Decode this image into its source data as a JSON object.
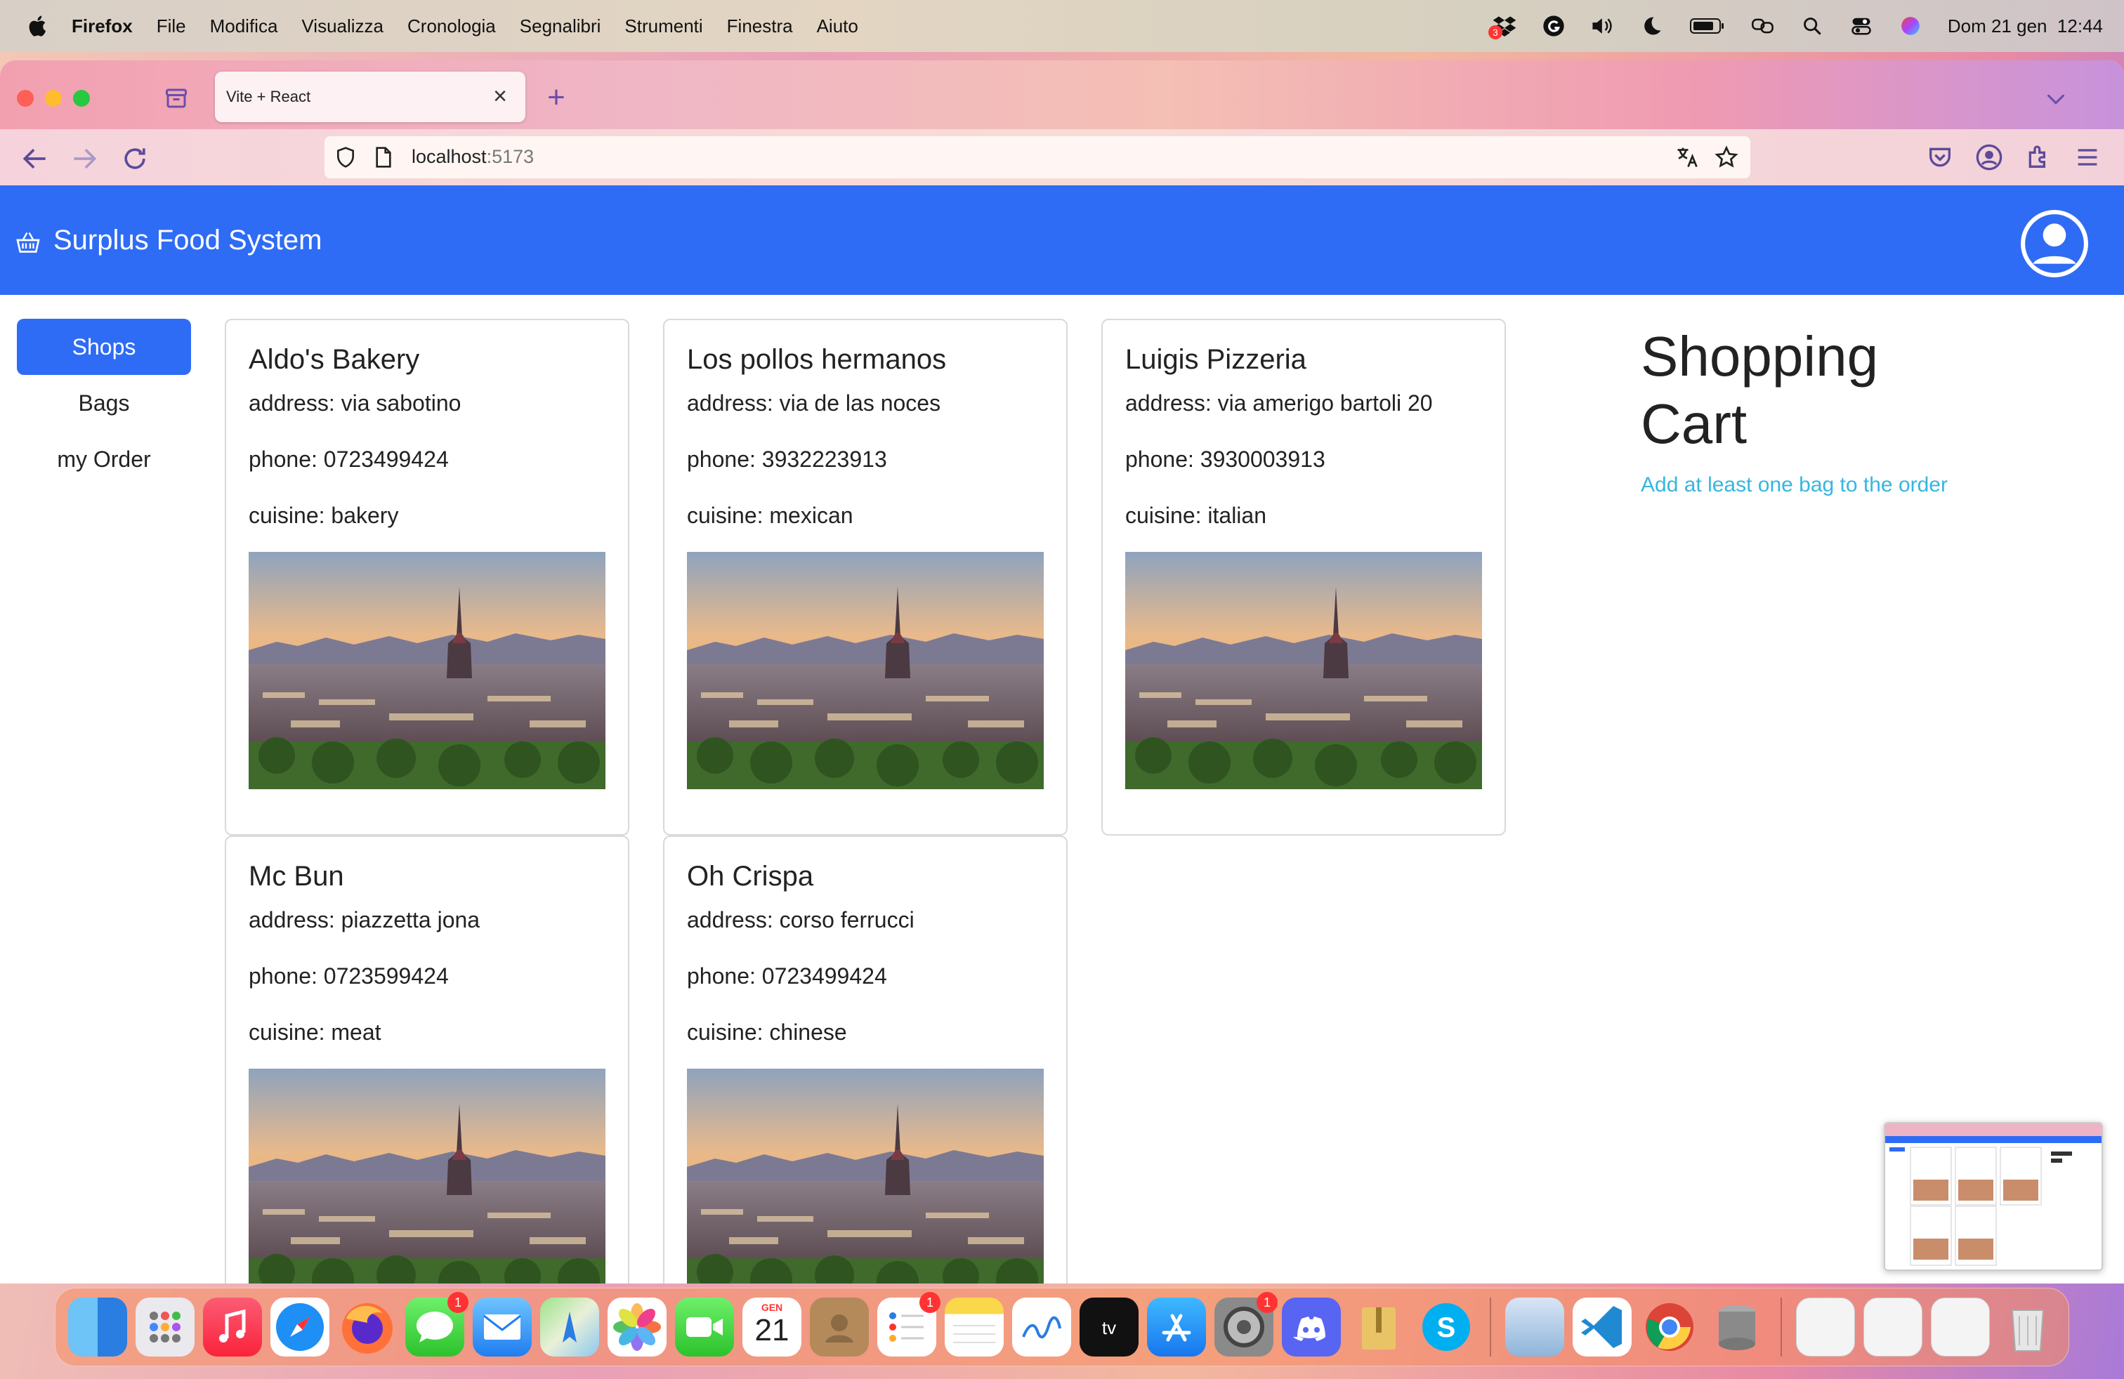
{
  "menubar": {
    "app": "Firefox",
    "items": [
      "File",
      "Modifica",
      "Visualizza",
      "Cronologia",
      "Segnalibri",
      "Strumenti",
      "Finestra",
      "Aiuto"
    ],
    "clock": "Dom 21 gen  12:44",
    "dropbox_badge": "3"
  },
  "browser": {
    "tab_title": "Vite + React",
    "url_host": "localhost",
    "url_port": ":5173"
  },
  "app": {
    "brand": "Surplus Food System",
    "sidebar": [
      "Shops",
      "Bags",
      "my Order"
    ],
    "shops": [
      {
        "name": "Aldo's Bakery",
        "address": "address: via sabotino",
        "phone": "phone: 0723499424",
        "cuisine": "cuisine: bakery"
      },
      {
        "name": "Los pollos hermanos",
        "address": "address: via de las noces",
        "phone": "phone: 3932223913",
        "cuisine": "cuisine: mexican"
      },
      {
        "name": "Luigis Pizzeria",
        "address": "address: via amerigo bartoli 20",
        "phone": "phone: 3930003913",
        "cuisine": "cuisine: italian"
      },
      {
        "name": "Mc Bun",
        "address": "address: piazzetta jona",
        "phone": "phone: 0723599424",
        "cuisine": "cuisine: meat"
      },
      {
        "name": "Oh Crispa",
        "address": "address: corso ferrucci",
        "phone": "phone: 0723499424",
        "cuisine": "cuisine: chinese"
      }
    ],
    "cart": {
      "title_line1": "Shopping",
      "title_line2": "Cart",
      "message": "Add at least one bag to the order"
    }
  },
  "dock": {
    "calendar_month": "GEN",
    "calendar_day": "21",
    "messages_badge": "1",
    "reminders_badge": "1",
    "settings_badge": "1"
  },
  "colors": {
    "primary": "#2f6cf5",
    "cart_message": "#36b6e0"
  }
}
